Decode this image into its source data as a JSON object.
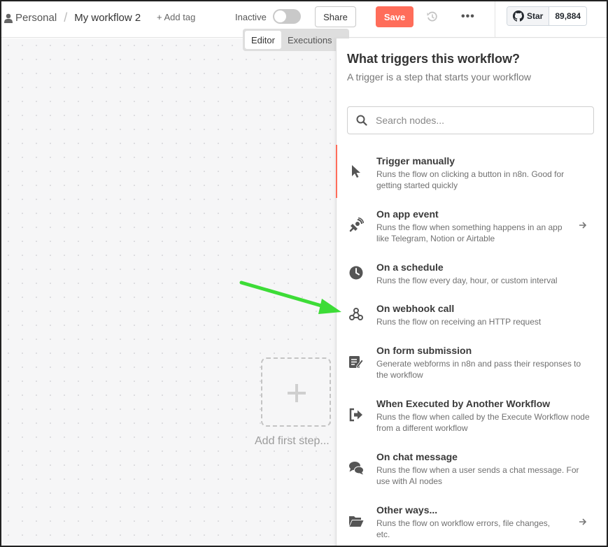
{
  "header": {
    "workspace": "Personal",
    "separator": "/",
    "workflow_name": "My workflow 2",
    "add_tag": "+ Add tag",
    "status_label": "Inactive",
    "share_label": "Share",
    "save_label": "Save",
    "more_label": "•••",
    "github": {
      "star_label": "Star",
      "count": "89,884"
    }
  },
  "tabs": [
    {
      "label": "Editor",
      "active": true
    },
    {
      "label": "Executions",
      "active": false
    }
  ],
  "canvas": {
    "add_first_step": "Add first step..."
  },
  "panel": {
    "title": "What triggers this workflow?",
    "subtitle": "A trigger is a step that starts your workflow",
    "search_placeholder": "Search nodes...",
    "items": [
      {
        "title": "Trigger manually",
        "desc": "Runs the flow on clicking a button in n8n. Good for getting started quickly",
        "icon": "cursor-icon",
        "has_arrow": false,
        "selected": true
      },
      {
        "title": "On app event",
        "desc": "Runs the flow when something happens in an app like Telegram, Notion or Airtable",
        "icon": "satellite-icon",
        "has_arrow": true
      },
      {
        "title": "On a schedule",
        "desc": "Runs the flow every day, hour, or custom interval",
        "icon": "clock-icon",
        "has_arrow": false
      },
      {
        "title": "On webhook call",
        "desc": "Runs the flow on receiving an HTTP request",
        "icon": "webhook-icon",
        "has_arrow": false
      },
      {
        "title": "On form submission",
        "desc": "Generate webforms in n8n and pass their responses to the workflow",
        "icon": "form-icon",
        "has_arrow": false
      },
      {
        "title": "When Executed by Another Workflow",
        "desc": "Runs the flow when called by the Execute Workflow node from a different workflow",
        "icon": "sign-out-icon",
        "has_arrow": false
      },
      {
        "title": "On chat message",
        "desc": "Runs the flow when a user sends a chat message. For use with AI nodes",
        "icon": "comments-icon",
        "has_arrow": false
      },
      {
        "title": "Other ways...",
        "desc": "Runs the flow on workflow errors, file changes, etc.",
        "icon": "folder-open-icon",
        "has_arrow": true
      }
    ]
  },
  "colors": {
    "save": "#ff6d5a",
    "selected_bar": "#ff6d5a",
    "annotation_arrow": "#3ddc37"
  }
}
